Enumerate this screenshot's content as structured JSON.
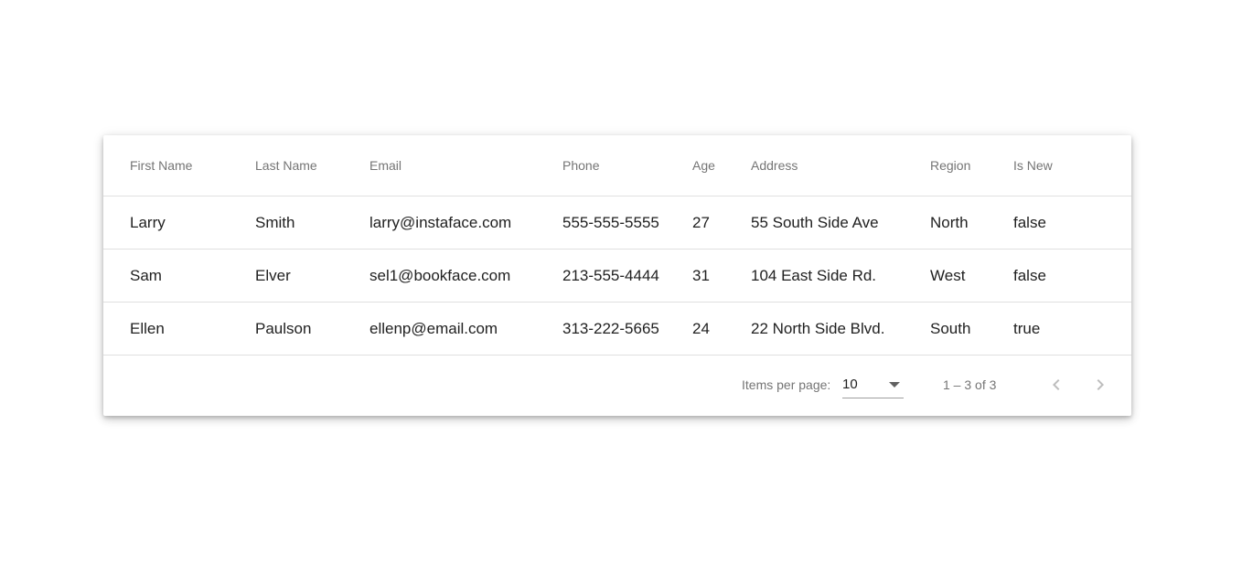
{
  "table": {
    "columns": [
      "First Name",
      "Last Name",
      "Email",
      "Phone",
      "Age",
      "Address",
      "Region",
      "Is New"
    ],
    "rows": [
      [
        "Larry",
        "Smith",
        "larry@instaface.com",
        "555-555-5555",
        "27",
        "55 South Side Ave",
        "North",
        "false"
      ],
      [
        "Sam",
        "Elver",
        "sel1@bookface.com",
        "213-555-4444",
        "31",
        "104 East Side Rd.",
        "West",
        "false"
      ],
      [
        "Ellen",
        "Paulson",
        "ellenp@email.com",
        "313-222-5665",
        "24",
        "22 North Side Blvd.",
        "South",
        "true"
      ]
    ]
  },
  "paginator": {
    "items_per_page_label": "Items per page:",
    "items_per_page_value": "10",
    "range_label": "1 – 3 of 3",
    "prev_icon": "chevron-left-icon",
    "next_icon": "chevron-right-icon"
  },
  "colors": {
    "header_text": "#757575",
    "body_text": "#212121",
    "divider": "#e0e0e0",
    "disabled_icon": "#bdbdbd"
  }
}
